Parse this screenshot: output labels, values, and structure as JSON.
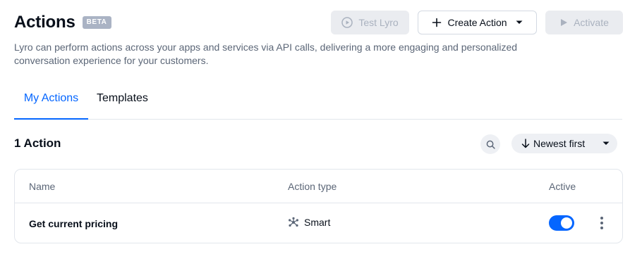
{
  "header": {
    "title": "Actions",
    "badge": "BETA",
    "description": "Lyro can perform actions across your apps and services via API calls, delivering a more engaging and personalized conversation experience for your customers."
  },
  "toolbar": {
    "test_label": "Test Lyro",
    "test_icon": "play-circle-icon",
    "create_label": "Create Action",
    "create_icon": "plus-icon",
    "activate_label": "Activate",
    "activate_icon": "play-icon"
  },
  "tabs": [
    {
      "label": "My Actions",
      "active": true
    },
    {
      "label": "Templates",
      "active": false
    }
  ],
  "list": {
    "count_label": "1 Action",
    "sort_label": "Newest first",
    "columns": [
      "Name",
      "Action type",
      "Active"
    ],
    "rows": [
      {
        "name": "Get current pricing",
        "type": "Smart",
        "type_icon": "smart-network-icon",
        "active": true
      }
    ]
  },
  "colors": {
    "accent": "#0566ff",
    "text": "#080f1a",
    "muted": "#5b6677",
    "badge": "#aab3c4",
    "disabled_bg": "#eaecf0",
    "border": "#e2e6ec"
  }
}
